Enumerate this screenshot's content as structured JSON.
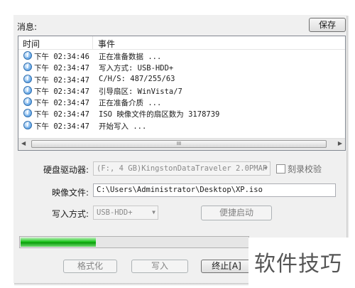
{
  "messages_label": "消息:",
  "save_button": "保存",
  "log": {
    "headers": {
      "time": "时间",
      "event": "事件"
    },
    "rows": [
      {
        "time": "下午 02:34:46",
        "event": "正在准备数据 ..."
      },
      {
        "time": "下午 02:34:47",
        "event": "写入方式: USB-HDD+"
      },
      {
        "time": "下午 02:34:47",
        "event": "C/H/S: 487/255/63"
      },
      {
        "time": "下午 02:34:47",
        "event": "引导扇区: WinVista/7"
      },
      {
        "time": "下午 02:34:47",
        "event": "正在准备介质 ..."
      },
      {
        "time": "下午 02:34:47",
        "event": "ISO 映像文件的扇区数为 3178739"
      },
      {
        "time": "下午 02:34:47",
        "event": "开始写入 ..."
      }
    ],
    "scroll_grip": "III"
  },
  "form": {
    "drive_label": "硬盘驱动器:",
    "drive_value": "(F:, 4 GB)KingstonDataTraveler 2.0PMAP",
    "verify_label": "刻录校验",
    "verify_checked": false,
    "image_label": "映像文件:",
    "image_value": "C:\\Users\\Administrator\\Desktop\\XP.iso",
    "method_label": "写入方式:",
    "method_value": "USB-HDD+",
    "boot_button": "便捷启动"
  },
  "progress_fraction": 0.33,
  "buttons": {
    "format": "格式化",
    "write": "写入",
    "stop": "终止[A]"
  },
  "watermark": "软件技巧",
  "colors": {
    "progress": "#1ec61e",
    "info_icon": "#2f6fb0"
  }
}
